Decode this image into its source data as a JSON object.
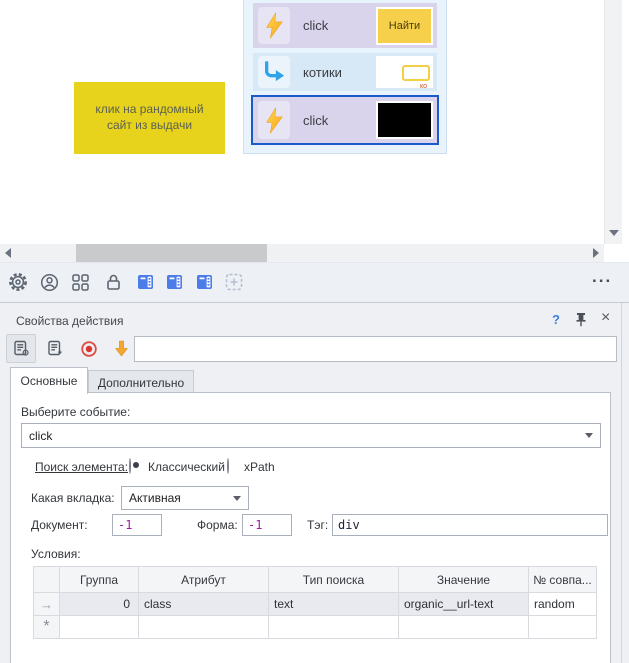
{
  "canvas": {
    "note": {
      "text": "клик на рандомный сайт из выдачи"
    },
    "actions": [
      {
        "label": "click",
        "icon": "lightning-icon",
        "thumb_label": "Найти"
      },
      {
        "label": "котики",
        "icon": "redirect-arrow-icon",
        "thumb_tiny": "ко"
      },
      {
        "label": "click",
        "icon": "lightning-icon"
      }
    ]
  },
  "main_toolbar": {
    "icons": [
      "gear-icon",
      "user-icon",
      "grid-icon",
      "lock-icon",
      "panel-icon",
      "panel-icon",
      "panel-icon",
      "add-region-icon"
    ],
    "overflow": "..."
  },
  "panel": {
    "title": "Свойства действия",
    "help": "?",
    "close": "×",
    "search_value": "",
    "toolbar_icons": [
      "doc-gear-icon",
      "doc-lightning-icon",
      "record-icon",
      "down-arrow-icon"
    ],
    "tabs": {
      "main": "Основные",
      "extra": "Дополнительно"
    },
    "form": {
      "event_label": "Выберите событие:",
      "event_value": "click",
      "element_search_label": "Поиск элемента:",
      "radio_classic": "Классический",
      "radio_xpath": "xPath",
      "which_tab_label": "Какая вкладка:",
      "which_tab_value": "Активная",
      "document_label": "Документ:",
      "document_value": "-1",
      "form_label": "Форма:",
      "form_value": "-1",
      "tag_label": "Тэг:",
      "tag_value": "div",
      "conditions_label": "Условия:"
    },
    "table": {
      "columns": [
        "Группа",
        "Атрибут",
        "Тип поиска",
        "Значение",
        "№ совпа..."
      ],
      "row_marker": "→",
      "new_row_marker": "*",
      "rows": [
        {
          "group": "0",
          "attribute": "class",
          "search_type": "text",
          "value": "organic__url-text",
          "match": "random"
        }
      ]
    }
  },
  "colors": {
    "selection_blue": "#1a5bc9",
    "note_yellow": "#e7d31c",
    "row_lavender": "#d9d3ec",
    "row_lightblue": "#d7e9f7",
    "thumb_yellow": "#f6d04b",
    "icon_blue": "#4c7ce8",
    "record_red": "#e23b35",
    "arrow_orange": "#f2a833",
    "value_magenta": "#a21ca2",
    "help_blue": "#3f7fd6"
  }
}
